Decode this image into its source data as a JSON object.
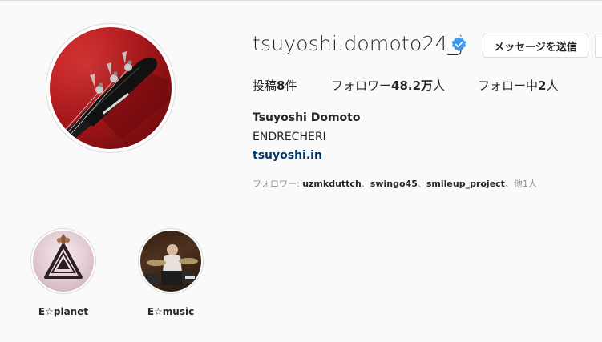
{
  "profile": {
    "username": "tsuyoshi.domoto24_j",
    "verified_icon": "verified-badge-icon",
    "message_button": "メッセージを送信",
    "stats": {
      "posts_label": "投稿",
      "posts_value": "8",
      "posts_suffix": "件",
      "followers_label": "フォロワー",
      "followers_value": "48.2万",
      "followers_suffix": "人",
      "following_label": "フォロー中",
      "following_value": "2",
      "following_suffix": "人"
    },
    "full_name": "Tsuyoshi Domoto",
    "bio": "ENDRECHERI",
    "link": "tsuyoshi.in",
    "followed_by": {
      "prefix": "フォロワー: ",
      "names": [
        "uzmkduttch",
        "swingo45",
        "smileup_project"
      ],
      "separator": "、",
      "suffix": "、他1人"
    }
  },
  "highlights": [
    {
      "label": "E☆planet",
      "icon": "eplanet-logo-icon"
    },
    {
      "label": "E☆music",
      "icon": "drummer-photo"
    }
  ],
  "colors": {
    "background": "#fafafa",
    "border": "#dbdbdb",
    "link": "#00376b",
    "verified": "#3897f0",
    "avatar_red": "#c2181c"
  }
}
